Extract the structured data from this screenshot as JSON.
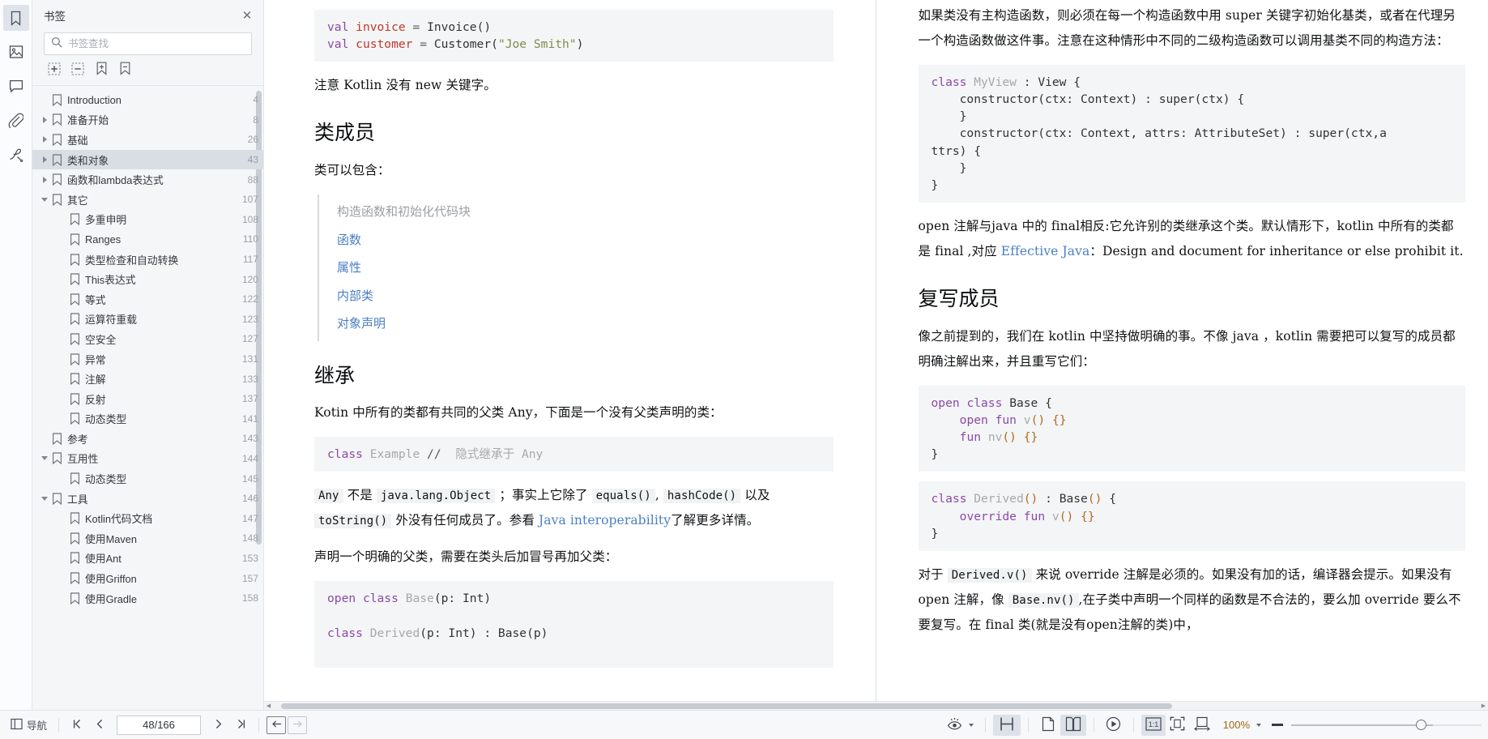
{
  "rail": {
    "items": [
      {
        "name": "bookmarks",
        "icon": "bookmark-icon",
        "active": true
      },
      {
        "name": "thumbnails",
        "icon": "image-icon",
        "active": false
      },
      {
        "name": "comments",
        "icon": "comment-icon",
        "active": false
      },
      {
        "name": "attachments",
        "icon": "paperclip-icon",
        "active": false
      },
      {
        "name": "signatures",
        "icon": "signature-icon",
        "active": false
      }
    ]
  },
  "bookmarks_panel": {
    "title": "书签",
    "close_label": "✕",
    "search": {
      "placeholder": "书签查找",
      "value": ""
    },
    "tools": [
      {
        "name": "expand-all",
        "icon": "expand-all-icon"
      },
      {
        "name": "collapse-all",
        "icon": "collapse-all-icon"
      },
      {
        "name": "add-bookmark",
        "icon": "add-bookmark-icon"
      },
      {
        "name": "remove-bookmark",
        "icon": "remove-bookmark-icon"
      }
    ],
    "items": [
      {
        "label": "Introduction",
        "page": "4",
        "indent": 0,
        "twisty": "none",
        "selected": false
      },
      {
        "label": "准备开始",
        "page": "8",
        "indent": 0,
        "twisty": "closed",
        "selected": false
      },
      {
        "label": "基础",
        "page": "26",
        "indent": 0,
        "twisty": "closed",
        "selected": false
      },
      {
        "label": "类和对象",
        "page": "43",
        "indent": 0,
        "twisty": "closed",
        "selected": true
      },
      {
        "label": "函数和lambda表达式",
        "page": "88",
        "indent": 0,
        "twisty": "closed",
        "selected": false
      },
      {
        "label": "其它",
        "page": "107",
        "indent": 0,
        "twisty": "open",
        "selected": false
      },
      {
        "label": "多重申明",
        "page": "108",
        "indent": 1,
        "twisty": "none",
        "selected": false
      },
      {
        "label": "Ranges",
        "page": "110",
        "indent": 1,
        "twisty": "none",
        "selected": false
      },
      {
        "label": "类型检查和自动转换",
        "page": "117",
        "indent": 1,
        "twisty": "none",
        "selected": false
      },
      {
        "label": "This表达式",
        "page": "120",
        "indent": 1,
        "twisty": "none",
        "selected": false
      },
      {
        "label": "等式",
        "page": "122",
        "indent": 1,
        "twisty": "none",
        "selected": false
      },
      {
        "label": "运算符重载",
        "page": "123",
        "indent": 1,
        "twisty": "none",
        "selected": false
      },
      {
        "label": "空安全",
        "page": "127",
        "indent": 1,
        "twisty": "none",
        "selected": false
      },
      {
        "label": "异常",
        "page": "131",
        "indent": 1,
        "twisty": "none",
        "selected": false
      },
      {
        "label": "注解",
        "page": "133",
        "indent": 1,
        "twisty": "none",
        "selected": false
      },
      {
        "label": "反射",
        "page": "137",
        "indent": 1,
        "twisty": "none",
        "selected": false
      },
      {
        "label": "动态类型",
        "page": "141",
        "indent": 1,
        "twisty": "none",
        "selected": false
      },
      {
        "label": "参考",
        "page": "143",
        "indent": 0,
        "twisty": "none",
        "selected": false
      },
      {
        "label": "互用性",
        "page": "144",
        "indent": 0,
        "twisty": "open",
        "selected": false
      },
      {
        "label": "动态类型",
        "page": "145",
        "indent": 1,
        "twisty": "none",
        "selected": false
      },
      {
        "label": "工具",
        "page": "146",
        "indent": 0,
        "twisty": "open",
        "selected": false
      },
      {
        "label": "Kotlin代码文档",
        "page": "147",
        "indent": 1,
        "twisty": "none",
        "selected": false
      },
      {
        "label": "使用Maven",
        "page": "148",
        "indent": 1,
        "twisty": "none",
        "selected": false
      },
      {
        "label": "使用Ant",
        "page": "153",
        "indent": 1,
        "twisty": "none",
        "selected": false
      },
      {
        "label": "使用Griffon",
        "page": "157",
        "indent": 1,
        "twisty": "none",
        "selected": false
      },
      {
        "label": "使用Gradle",
        "page": "158",
        "indent": 1,
        "twisty": "none",
        "selected": false
      }
    ]
  },
  "document": {
    "left_page": {
      "code_top_line1_kw": "val",
      "code_top_line1_rest": " invoice = Invoice()",
      "code_top_line2_kw": "val",
      "code_top_line2_rest": " customer = Customer(\"Joe Smith\")",
      "code_top": "val invoice = Invoice()\nval customer = Customer(\"Joe Smith\")",
      "para_new_keyword": "注意 Kotlin 没有 new 关键字。",
      "heading_members": "类成员",
      "para_class_can_contain": "类可以包含：",
      "toc": [
        {
          "label": "构造函数和初始化代码块",
          "muted": true
        },
        {
          "label": "函数",
          "muted": false
        },
        {
          "label": "属性",
          "muted": false
        },
        {
          "label": "内部类",
          "muted": false
        },
        {
          "label": "对象声明",
          "muted": false
        }
      ],
      "heading_inherit": "继承",
      "para_any": "Kotin 中所有的类都有共同的父类 Any，下面是一个没有父类声明的类：",
      "code_example": "class Example //  隐式继承于 Any",
      "para_any_not_object_1": "Any",
      "para_any_not_object_2": "不是",
      "para_any_not_object_3": "java.lang.Object",
      "para_any_not_object_4": "；事实上它除了",
      "para_any_not_object_5": "equals()",
      "para_any_not_object_6": ",",
      "para_any_not_object_7": "hashCode()",
      "para_any_not_object_8": "以及",
      "para_any_not_object_9": "toString()",
      "para_any_not_object_10": "外没有任何成员了。参看",
      "para_any_link": "Java interoperability",
      "para_any_not_object_11": "了解更多详情。",
      "para_declare_super": "声明一个明确的父类，需要在类头后加冒号再加父类：",
      "code_base": "open class Base(p: Int)",
      "code_derived": "class Derived(p: Int) : Base(p)"
    },
    "right_page": {
      "para_no_primary": "如果类没有主构造函数，则必须在每一个构造函数中用 super 关键字初始化基类，或者在代理另一个构造函数做这件事。注意在这种情形中不同的二级构造函数可以调用基类不同的构造方法：",
      "code_myview": "class MyView : View {\n    constructor(ctx: Context) : super(ctx) {\n    }\n    constructor(ctx: Context, attrs: AttributeSet) : super(ctx,a\nttrs) {\n    }\n}",
      "para_open_1": "open 注解与java 中的 final相反:它允许别的类继承这个类。默认情形下，kotlin 中所有的类都是 final ,对应 ",
      "para_open_link": "Effective Java",
      "para_open_2": "：Design and document for inheritance or else prohibit it.",
      "heading_override": "复写成员",
      "para_override_intro": "像之前提到的，我们在 kotlin 中坚持做明确的事。不像 java ，kotlin 需要把可以复写的成员都明确注解出来，并且重写它们：",
      "code_base_open": "open class Base {\n    open fun v() {}\n    fun nv() {}\n}",
      "code_derived_override": "class Derived() : Base() {\n    override fun v() {}\n}",
      "para_footer_1": "对于",
      "para_footer_code1": "Derived.v()",
      "para_footer_2": "来说 override 注解是必须的。如果没有加的话，编译器会提示。如果没有 open 注解，像",
      "para_footer_code2": "Base.nv()",
      "para_footer_3": ",在子类中声明一个同样的函数是不合法的，要么加 override 要么不要复写。在 final 类(就是没有open注解的类)中，"
    }
  },
  "statusbar": {
    "nav_label": "导航",
    "first_page_icon": "first-page-icon",
    "prev_page_icon": "prev-page-icon",
    "page_value": "48/166",
    "next_page_icon": "next-page-icon",
    "last_page_icon": "last-page-icon",
    "back_icon": "back-arrow-icon",
    "forward_icon": "forward-arrow-icon",
    "view_mode_icon": "eye-icon",
    "single_row_icon": "horizontal-split-icon",
    "single_page_icon": "single-page-icon",
    "two_page_icon": "two-page-icon",
    "presentation_icon": "play-icon",
    "actual_size_icon": "actual-size-icon",
    "fit_page_icon": "fit-page-icon",
    "fit_width_icon": "fit-width-icon",
    "zoom_label": "100%",
    "zoom_minus": "−",
    "zoom_value": 100
  }
}
